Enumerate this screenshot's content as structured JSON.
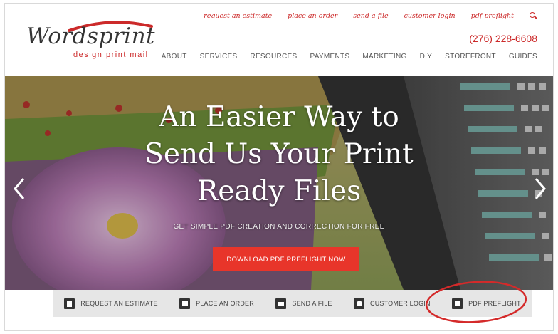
{
  "brand": {
    "name": "Wordsprint",
    "tagline": "design print mail"
  },
  "util_nav": [
    {
      "label": "request an estimate"
    },
    {
      "label": "place an order"
    },
    {
      "label": "send a file"
    },
    {
      "label": "customer login"
    },
    {
      "label": "pdf preflight"
    }
  ],
  "phone": "(276) 228-6608",
  "main_nav": [
    {
      "label": "ABOUT"
    },
    {
      "label": "SERVICES"
    },
    {
      "label": "RESOURCES"
    },
    {
      "label": "PAYMENTS"
    },
    {
      "label": "MARKETING"
    },
    {
      "label": "DIY"
    },
    {
      "label": "STOREFRONT"
    },
    {
      "label": "GUIDES"
    }
  ],
  "hero": {
    "title_lines": [
      "An Easier Way to",
      "Send Us Your Print",
      "Ready Files"
    ],
    "subtitle": "GET SIMPLE PDF CREATION AND CORRECTION FOR FREE",
    "cta_label": "DOWNLOAD PDF PREFLIGHT NOW"
  },
  "quick_links": [
    {
      "label": "REQUEST AN ESTIMATE",
      "icon": "document-icon"
    },
    {
      "label": "PLACE AN ORDER",
      "icon": "cart-icon"
    },
    {
      "label": "SEND A FILE",
      "icon": "upload-icon"
    },
    {
      "label": "CUSTOMER LOGIN",
      "icon": "lock-icon"
    },
    {
      "label": "PDF PREFLIGHT",
      "icon": "preflight-icon"
    }
  ],
  "colors": {
    "brand_red": "#cc2a2a",
    "cta_red": "#e8352a",
    "quickbar_bg": "#e6e6e6"
  }
}
